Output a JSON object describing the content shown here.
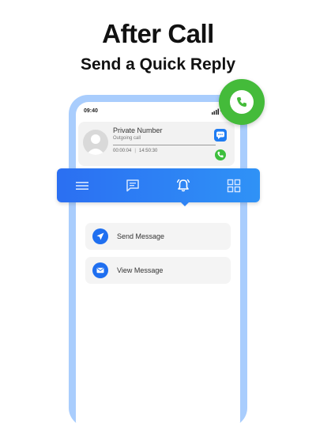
{
  "header": {
    "title": "After Call",
    "subtitle": "Send a Quick Reply"
  },
  "status_bar": {
    "time": "09:40"
  },
  "call_card": {
    "caller_name": "Private Number",
    "call_status": "Outgoing call",
    "duration": "00:00:04",
    "separator": "|",
    "timestamp": "14:50:30"
  },
  "nav_bar": {
    "items": [
      {
        "icon": "menu-icon"
      },
      {
        "icon": "message-icon"
      },
      {
        "icon": "bell-icon",
        "active": true
      },
      {
        "icon": "grid-icon"
      }
    ]
  },
  "actions": [
    {
      "label": "Send Message",
      "icon": "send-icon"
    },
    {
      "label": "View Message",
      "icon": "mail-icon"
    }
  ],
  "colors": {
    "accent": "#2b6ff2",
    "call_green": "#44bb3a",
    "phone_frame": "#a9cdfd"
  }
}
